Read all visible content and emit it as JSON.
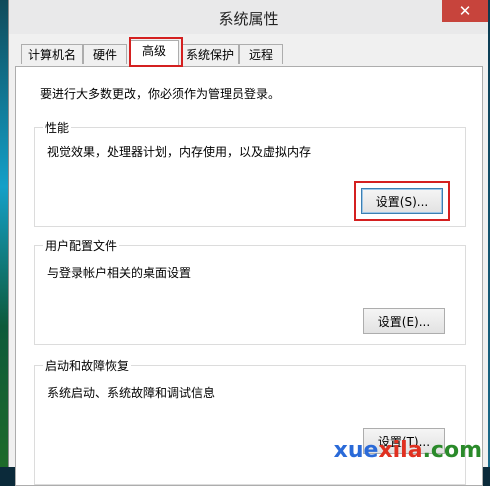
{
  "window": {
    "title": "系统属性",
    "close_glyph": "✕"
  },
  "tabs": [
    {
      "label": "计算机名"
    },
    {
      "label": "硬件"
    },
    {
      "label": "高级"
    },
    {
      "label": "系统保护"
    },
    {
      "label": "远程"
    }
  ],
  "panel": {
    "notice": "要进行大多数更改，你必须作为管理员登录。",
    "performance": {
      "label": "性能",
      "description": "视觉效果，处理器计划，内存使用，以及虚拟内存",
      "button": "设置(S)..."
    },
    "user_profile": {
      "label": "用户配置文件",
      "description": "与登录帐户相关的桌面设置",
      "button": "设置(E)..."
    },
    "startup": {
      "label": "启动和故障恢复",
      "description": "系统启动、系统故障和调试信息",
      "button": "设置(T)..."
    }
  },
  "watermark": {
    "part1": "xue",
    "part2": "xila",
    "part3": ".com"
  },
  "colors": {
    "highlight": "#d42020",
    "close_button": "#c7443c"
  }
}
